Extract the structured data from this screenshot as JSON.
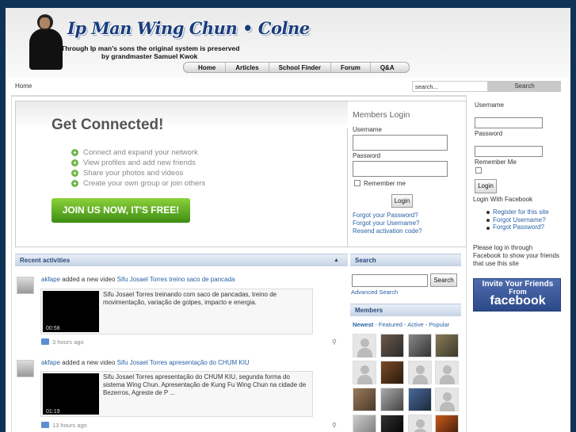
{
  "header": {
    "site_title": "Ip Man Wing Chun • Colne",
    "tagline_1": "Through Ip man's sons the original system is preserved",
    "tagline_2": "by grandmaster Samuel Kwok"
  },
  "nav": {
    "items": [
      "Home",
      "Articles",
      "School Finder",
      "Forum",
      "Q&A"
    ]
  },
  "breadcrumb": "Home",
  "top_search": {
    "placeholder": "search...",
    "button": "Search"
  },
  "connect": {
    "title": "Get Connected!",
    "features": [
      "Connect and expand your network",
      "View profiles and add new friends",
      "Share your photos and videos",
      "Create your own group or join others"
    ],
    "cta": "JOIN US NOW, IT'S FREE!"
  },
  "members_login": {
    "title": "Members Login",
    "username_label": "Username",
    "password_label": "Password",
    "remember": "Remember me",
    "button": "Login",
    "links": [
      "Forgot your Password?",
      "Forgot your Username?",
      "Resend activation code?"
    ]
  },
  "recent": {
    "title": "Recent activities",
    "items": [
      {
        "user": "akfape",
        "action": "added a new video",
        "video_title": "Sifu Josael Torres treino saco de pancada",
        "duration": "00:58",
        "description": "Sifu Josael Torres treinando com saco de pancadas, treino de movimentação, variação de golpes, impacto e energia.",
        "time": "3 hours ago"
      },
      {
        "user": "akfape",
        "action": "added a new video",
        "video_title": "Sifu Josael Torres apresentação do CHUM KIU",
        "duration": "01:19",
        "description": "Sifu Josael Torres apresentação do CHUM KIU, segunda forma do sistema Wing Chun. Apresentação de Kung Fu Wing Chun na cidade de Bezerros, Agreste de P ...",
        "time": "13 hours ago"
      }
    ]
  },
  "search": {
    "title": "Search",
    "button": "Search",
    "advanced": "Advanced Search"
  },
  "members": {
    "title": "Members",
    "tab_newest": "Newest",
    "tabs_rest": " - Featured - Active - Popular"
  },
  "sidebar": {
    "username_label": "Username",
    "password_label": "Password",
    "remember": "Remember Me",
    "button": "Login",
    "fb_login": "Login With Facebook",
    "links": [
      "Register for this site",
      "Forgot Username?",
      "Forgot Password?"
    ],
    "fb_note": "Please log in through Facebook to show your friends that use this site",
    "fb_banner": {
      "line1": "Invite Your Friends",
      "line2": "From",
      "line3": "facebook"
    }
  },
  "colors": {
    "page_background": "#0f3357",
    "link": "#2a62a6",
    "cta_green": "#5aac24",
    "facebook_blue": "#3b5998"
  }
}
